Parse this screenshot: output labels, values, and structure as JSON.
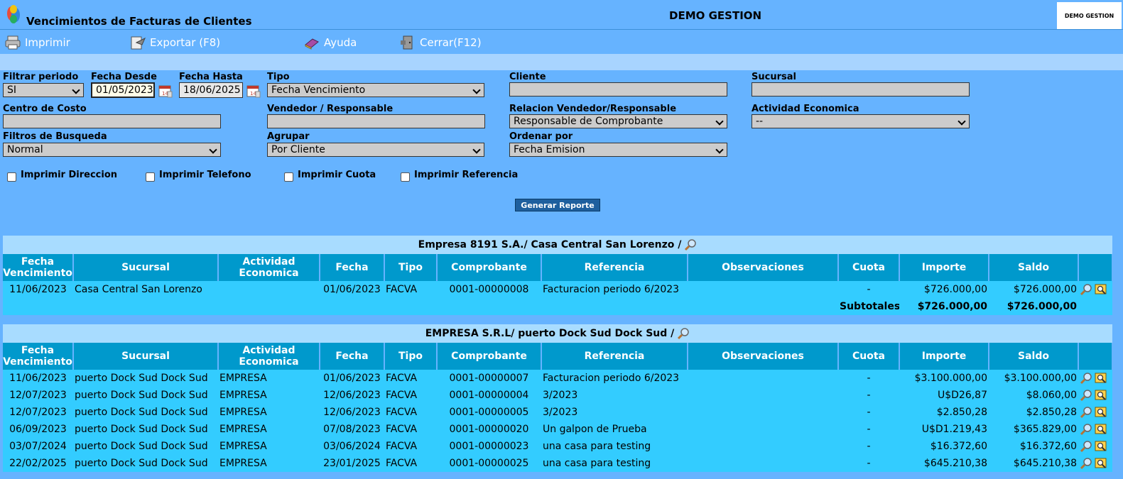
{
  "window": {
    "title": "Vencimientos de Facturas de Clientes",
    "company": "DEMO GESTION",
    "brand": "DEMO GESTION"
  },
  "toolbar": {
    "print": "Imprimir",
    "export": "Exportar (F8)",
    "help": "Ayuda",
    "close": "Cerrar(F12)"
  },
  "filters": {
    "periodo_label": "Filtrar periodo",
    "periodo_value": "SI",
    "desde_label": "Fecha Desde",
    "desde_value": "01/05/2023",
    "hasta_label": "Fecha Hasta",
    "hasta_value": "18/06/2025",
    "tipo_label": "Tipo",
    "tipo_value": "Fecha Vencimiento",
    "cliente_label": "Cliente",
    "cliente_value": "",
    "sucursal_label": "Sucursal",
    "sucursal_value": "",
    "centro_label": "Centro de Costo",
    "centro_value": "",
    "vendedor_label": "Vendedor / Responsable",
    "vendedor_value": "",
    "relacion_label": "Relacion Vendedor/Responsable",
    "relacion_value": "Responsable de Comprobante",
    "actividad_label": "Actividad Economica",
    "actividad_value": "--",
    "busqueda_label": "Filtros de Busqueda",
    "busqueda_value": "Normal",
    "agrupar_label": "Agrupar",
    "agrupar_value": "Por Cliente",
    "ordenar_label": "Ordenar por",
    "ordenar_value": "Fecha Emision",
    "chk_direccion": "Imprimir Direccion",
    "chk_telefono": "Imprimir Telefono",
    "chk_cuota": "Imprimir Cuota",
    "chk_referencia": "Imprimir Referencia",
    "generate": "Generar Reporte"
  },
  "columns": {
    "fecha_venc_1": "Fecha",
    "fecha_venc_2": "Vencimiento",
    "sucursal": "Sucursal",
    "actividad_1": "Actividad",
    "actividad_2": "Economica",
    "fecha": "Fecha",
    "tipo": "Tipo",
    "comprobante": "Comprobante",
    "referencia": "Referencia",
    "observaciones": "Observaciones",
    "cuota": "Cuota",
    "importe": "Importe",
    "saldo": "Saldo"
  },
  "group1": {
    "title": "Empresa 8191 S.A./ Casa Central San Lorenzo /",
    "rows": [
      {
        "venc": "11/06/2023",
        "sucursal": "Casa Central San Lorenzo",
        "actividad": "",
        "fecha": "01/06/2023",
        "tipo": "FACVA",
        "comprobante": "0001-00000008",
        "referencia": "Facturacion periodo 6/2023",
        "obs": "",
        "cuota": "-",
        "importe": "$726.000,00",
        "saldo": "$726.000,00"
      }
    ],
    "subtotal_label": "Subtotales",
    "subtotal_importe": "$726.000,00",
    "subtotal_saldo": "$726.000,00"
  },
  "group2": {
    "title": "EMPRESA S.R.L/ puerto Dock Sud Dock Sud /",
    "rows": [
      {
        "venc": "11/06/2023",
        "sucursal": "puerto Dock Sud Dock Sud",
        "actividad": "EMPRESA",
        "fecha": "01/06/2023",
        "tipo": "FACVA",
        "comprobante": "0001-00000007",
        "referencia": "Facturacion periodo 6/2023",
        "obs": "",
        "cuota": "-",
        "importe": "$3.100.000,00",
        "saldo": "$3.100.000,00"
      },
      {
        "venc": "12/07/2023",
        "sucursal": "puerto Dock Sud Dock Sud",
        "actividad": "EMPRESA",
        "fecha": "12/06/2023",
        "tipo": "FACVA",
        "comprobante": "0001-00000004",
        "referencia": "3/2023",
        "obs": "",
        "cuota": "-",
        "importe": "U$D26,87",
        "saldo": "$8.060,00"
      },
      {
        "venc": "12/07/2023",
        "sucursal": "puerto Dock Sud Dock Sud",
        "actividad": "EMPRESA",
        "fecha": "12/06/2023",
        "tipo": "FACVA",
        "comprobante": "0001-00000005",
        "referencia": "3/2023",
        "obs": "",
        "cuota": "-",
        "importe": "$2.850,28",
        "saldo": "$2.850,28"
      },
      {
        "venc": "06/09/2023",
        "sucursal": "puerto Dock Sud Dock Sud",
        "actividad": "EMPRESA",
        "fecha": "07/08/2023",
        "tipo": "FACVA",
        "comprobante": "0001-00000020",
        "referencia": "Un galpon de Prueba",
        "obs": "",
        "cuota": "-",
        "importe": "U$D1.219,43",
        "saldo": "$365.829,00"
      },
      {
        "venc": "03/07/2024",
        "sucursal": "puerto Dock Sud Dock Sud",
        "actividad": "EMPRESA",
        "fecha": "03/06/2024",
        "tipo": "FACVA",
        "comprobante": "0001-00000023",
        "referencia": "una casa para testing",
        "obs": "",
        "cuota": "-",
        "importe": "$16.372,60",
        "saldo": "$16.372,60"
      },
      {
        "venc": "22/02/2025",
        "sucursal": "puerto Dock Sud Dock Sud",
        "actividad": "EMPRESA",
        "fecha": "23/01/2025",
        "tipo": "FACVA",
        "comprobante": "0001-00000025",
        "referencia": "una casa para testing",
        "obs": "",
        "cuota": "-",
        "importe": "$645.210,38",
        "saldo": "$645.210,38"
      }
    ]
  }
}
